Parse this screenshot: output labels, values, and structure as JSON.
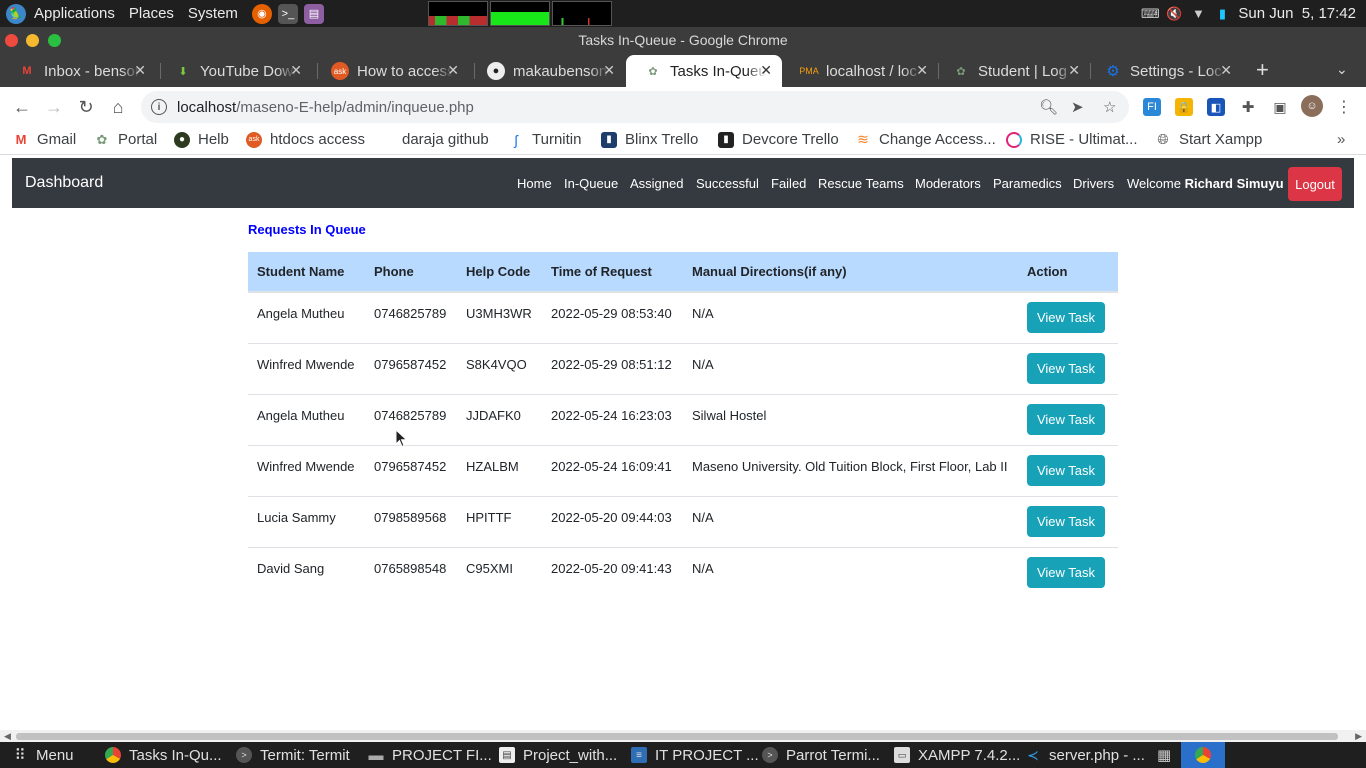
{
  "os_panel": {
    "menus": [
      "Applications",
      "Places",
      "System"
    ],
    "clock": "Sun Jun  5, 17:42"
  },
  "window": {
    "title": "Tasks In-Queue - Google Chrome"
  },
  "tabs": [
    {
      "label": "Inbox - benson",
      "icon": "gmail-icon"
    },
    {
      "label": "YouTube Down",
      "icon": "download-icon"
    },
    {
      "label": "How to access",
      "icon": "ask-icon"
    },
    {
      "label": "makaubenson",
      "icon": "github-icon"
    },
    {
      "label": "Tasks In-Queue",
      "icon": "site-icon",
      "active": true
    },
    {
      "label": "localhost / loc",
      "icon": "phpmyadmin-icon"
    },
    {
      "label": "Student | Log",
      "icon": "site-icon"
    },
    {
      "label": "Settings - Loc",
      "icon": "gear-icon"
    }
  ],
  "toolbar": {
    "url_host": "localhost",
    "url_path": "/maseno-E-help/admin/inqueue.php"
  },
  "bookmarks": [
    {
      "label": "Gmail"
    },
    {
      "label": "Portal"
    },
    {
      "label": "Helb"
    },
    {
      "label": "htdocs access"
    },
    {
      "label": "daraja github"
    },
    {
      "label": "Turnitin"
    },
    {
      "label": "Blinx Trello"
    },
    {
      "label": "Devcore Trello"
    },
    {
      "label": "Change Access..."
    },
    {
      "label": "RISE - Ultimat..."
    },
    {
      "label": "Start Xampp"
    }
  ],
  "navbar": {
    "brand": "Dashboard",
    "links": [
      "Home",
      "In-Queue",
      "Assigned",
      "Successful",
      "Failed",
      "Rescue Teams",
      "Moderators",
      "Paramedics",
      "Drivers"
    ],
    "welcome_prefix": "Welcome",
    "user_name": "Richard Simuyu",
    "logout": "Logout"
  },
  "main": {
    "section_title": "Requests In Queue",
    "columns": [
      "Student Name",
      "Phone",
      "Help Code",
      "Time of Request",
      "Manual Directions(if any)",
      "Action"
    ],
    "rows": [
      {
        "name": "Angela Mutheu",
        "phone": "0746825789",
        "code": "U3MH3WR",
        "time": "2022-05-29 08:53:40",
        "directions": "N/A",
        "action": "View Task"
      },
      {
        "name": "Winfred Mwende",
        "phone": "0796587452",
        "code": "S8K4VQO",
        "time": "2022-05-29 08:51:12",
        "directions": "N/A",
        "action": "View Task"
      },
      {
        "name": "Angela Mutheu",
        "phone": "0746825789",
        "code": "JJDAFK0",
        "time": "2022-05-24 16:23:03",
        "directions": "Silwal Hostel",
        "action": "View Task"
      },
      {
        "name": "Winfred Mwende",
        "phone": "0796587452",
        "code": "HZALBM",
        "time": "2022-05-24 16:09:41",
        "directions": "Maseno University. Old Tuition Block, First Floor, Lab II",
        "action": "View Task"
      },
      {
        "name": "Lucia Sammy",
        "phone": "0798589568",
        "code": "HPITTF",
        "time": "2022-05-20 09:44:03",
        "directions": "N/A",
        "action": "View Task"
      },
      {
        "name": "David Sang",
        "phone": "0765898548",
        "code": "C95XMI",
        "time": "2022-05-20 09:41:43",
        "directions": "N/A",
        "action": "View Task"
      }
    ]
  },
  "taskbar": {
    "menu": "Menu",
    "items": [
      "Tasks In-Qu...",
      "Termit: Termit",
      "PROJECT FI...",
      "Project_with...",
      "IT PROJECT ...",
      "Parrot Termi...",
      "XAMPP 7.4.2...",
      "server.php - ..."
    ]
  },
  "colors": {
    "navbar_bg": "#343a40",
    "logout_bg": "#dc3545",
    "view_button_bg": "#17a2b8",
    "table_header_bg": "#b8daff",
    "section_title": "#0000ff"
  }
}
